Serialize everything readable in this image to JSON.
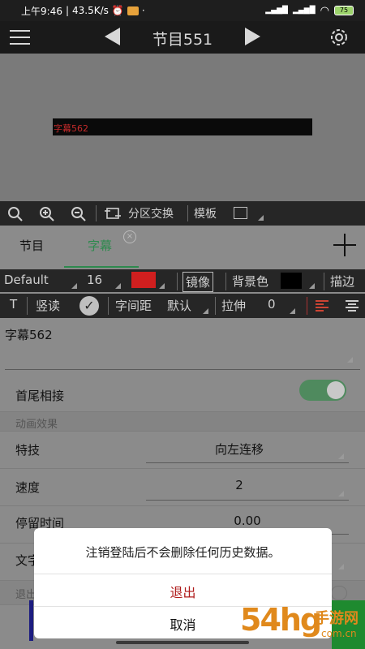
{
  "status_bar": {
    "time": "上午9:46",
    "net_speed": "43.5K/s",
    "dot": "·",
    "signal": "HD",
    "battery": "75"
  },
  "app_bar": {
    "title": "节目551"
  },
  "preview": {
    "text": "字幕562"
  },
  "toolbar": {
    "swap_label": "分区交换",
    "template_label": "模板"
  },
  "tabs": {
    "program": "节目",
    "subtitle": "字幕",
    "close": "×"
  },
  "style_row1": {
    "font": "Default",
    "size": "16",
    "mirror": "镜像",
    "background_color": "背景色",
    "stroke": "描边",
    "text_color": "#d01f1f"
  },
  "style_row2": {
    "t_label": "T",
    "vertical": "竖读",
    "spacing_label": "字间距",
    "spacing_value": "默认",
    "stretch_label": "拉伸",
    "stretch_value": "0"
  },
  "text_input": {
    "value": "字幕562"
  },
  "settings": {
    "head_tail": "首尾相接",
    "animation_section": "动画效果",
    "effect_label": "特技",
    "effect_value": "向左连移",
    "speed_label": "速度",
    "speed_value": "2",
    "pause_label": "停留时间",
    "pause_value": "0.00",
    "text_label_partial": "文字",
    "exit_label_partial": "退出"
  },
  "dialog": {
    "message": "注销登陆后不会删除任何历史数据。",
    "confirm": "退出",
    "cancel": "取消"
  },
  "watermark": {
    "text": "54hg手游网",
    "sub": "com.cn"
  }
}
